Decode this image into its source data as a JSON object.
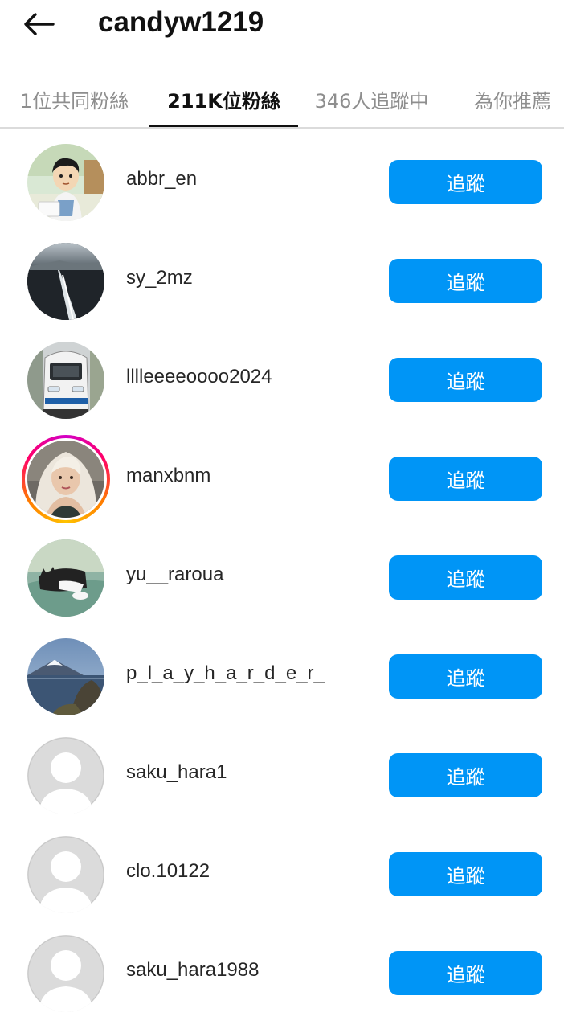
{
  "header": {
    "title": "candyw1219",
    "back_icon": "arrow-left-icon"
  },
  "tabs": [
    {
      "label": "1位共同粉絲",
      "active": false
    },
    {
      "label": "211K位粉絲",
      "active": true
    },
    {
      "label": "346人追蹤中",
      "active": false
    },
    {
      "label": "為你推薦",
      "active": false
    }
  ],
  "colors": {
    "accent": "#0095f6",
    "muted_text": "#8e8e8e",
    "divider": "#dbdbdb",
    "story_ring": [
      "#d300c5",
      "#ff0069",
      "#ff7a00",
      "#ffc300"
    ]
  },
  "followers": [
    {
      "username": "abbr_en",
      "button": "追蹤",
      "avatar": "cartoon-boy"
    },
    {
      "username": "sy_2mz",
      "button": "追蹤",
      "avatar": "ship-wake"
    },
    {
      "username": "lllleeeeoooo2024",
      "button": "追蹤",
      "avatar": "train"
    },
    {
      "username": "manxbnm",
      "button": "追蹤",
      "avatar": "woman-portrait",
      "has_story": true
    },
    {
      "username": "yu__raroua",
      "button": "追蹤",
      "avatar": "cat"
    },
    {
      "username": "p_l_a_y_h_a_r_d_e_r_",
      "button": "追蹤",
      "avatar": "mountain-lake"
    },
    {
      "username": "saku_hara1",
      "button": "追蹤",
      "avatar": "default-user"
    },
    {
      "username": "clo.10122",
      "button": "追蹤",
      "avatar": "default-user"
    },
    {
      "username": "saku_hara1988",
      "button": "追蹤",
      "avatar": "default-user"
    }
  ]
}
